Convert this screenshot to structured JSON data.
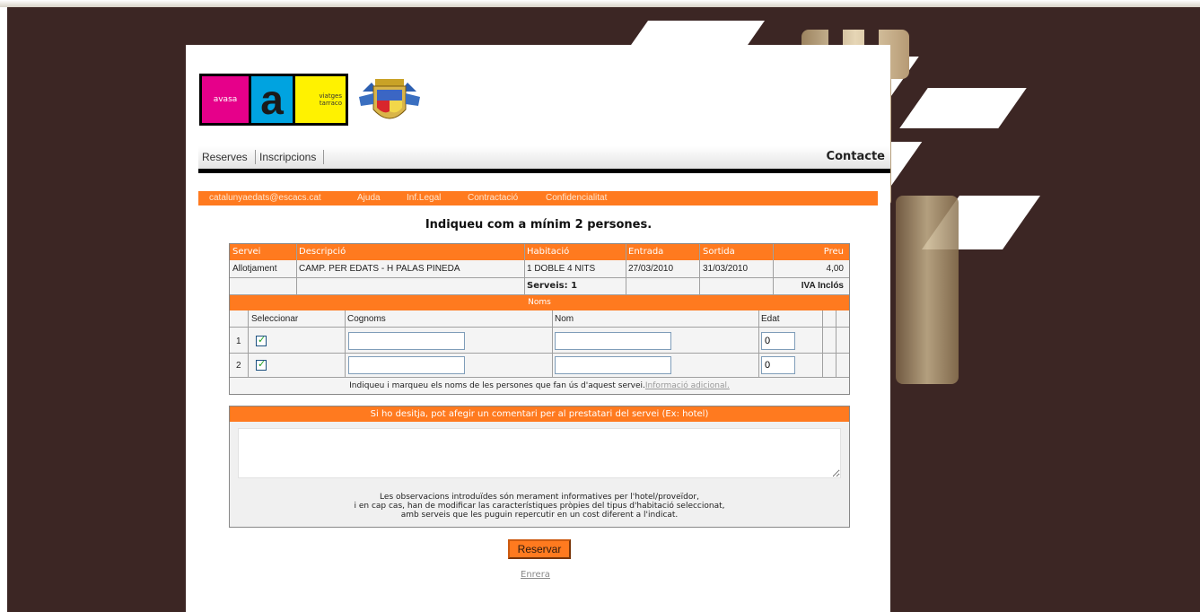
{
  "logo": {
    "brand_left": "avasa",
    "brand_right_line1": "viatges",
    "brand_right_line2": "tarraco",
    "brand_center": "a"
  },
  "nav": {
    "reserves": "Reserves",
    "inscripcions": "Inscripcions",
    "contacte": "Contacte"
  },
  "subnav": {
    "email": "catalunyaedats@escacs.cat",
    "ajuda": "Ajuda",
    "inf_legal": "Inf.Legal",
    "contractacio": "Contractació",
    "confidencialitat": "Confidencialitat"
  },
  "heading": "Indiqueu com a mínim 2 persones.",
  "booking": {
    "headers": {
      "servei": "Servei",
      "descripcio": "Descripció",
      "habitacio": "Habitació",
      "entrada": "Entrada",
      "sortida": "Sortida",
      "preu": "Preu"
    },
    "row": {
      "servei": "Allotjament",
      "descripcio": "CAMP. PER EDATS - H PALAS PINEDA",
      "habitacio": "1 DOBLE 4 NITS",
      "entrada": "27/03/2010",
      "sortida": "31/03/2010",
      "preu": "4,00"
    },
    "serveis": "Serveis: 1",
    "iva": "IVA Inclós"
  },
  "noms": {
    "title": "Noms",
    "headers": {
      "seleccionar": "Seleccionar",
      "cognoms": "Cognoms",
      "nom": "Nom",
      "edat": "Edat"
    },
    "rows": [
      {
        "num": "1",
        "checked": true,
        "cognoms": "",
        "nom": "",
        "edat": "0"
      },
      {
        "num": "2",
        "checked": true,
        "cognoms": "",
        "nom": "",
        "edat": "0"
      }
    ],
    "instruction": "Indiqueu i marqueu els noms de les persones que fan ús d'aquest servei.",
    "more_info": "Informació adicional."
  },
  "comment": {
    "title": "Si ho desitja, pot afegir un comentari per al prestatari del servei (Ex: hotel)",
    "value": "",
    "note_line1": "Les observacions introduïdes són merament informatives per l'hotel/proveïdor,",
    "note_line2": "i en cap cas, han de modificar las característiques pròpies del tipus d'habitació seleccionat,",
    "note_line3": "amb serveis que les puguin repercutir en un cost diferent a l'indicat."
  },
  "actions": {
    "reservar": "Reservar",
    "enrera": "Enrera"
  },
  "colors": {
    "accent": "#ff7a1f",
    "background": "#3c2624"
  }
}
